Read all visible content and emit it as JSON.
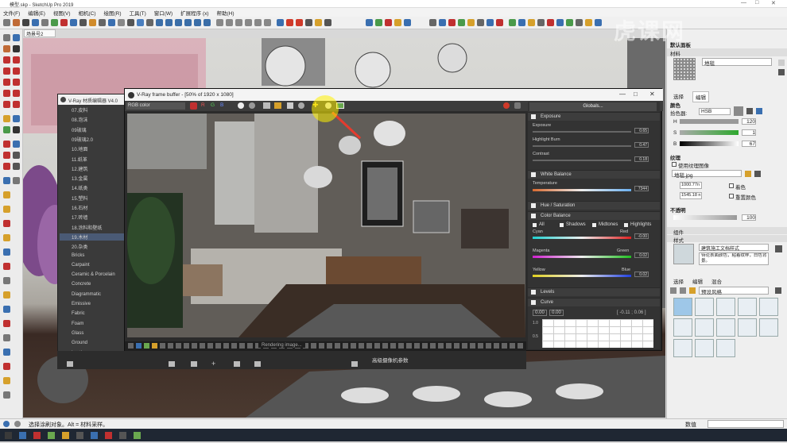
{
  "window": {
    "title": "模型.skp - SketchUp Pro 2019",
    "minimize": "—",
    "maximize": "□",
    "close": "✕"
  },
  "menu": [
    "文件(F)",
    "编辑(E)",
    "视图(V)",
    "相机(C)",
    "绘图(R)",
    "工具(T)",
    "窗口(W)",
    "扩展程序 (x)",
    "帮助(H)"
  ],
  "scene_tab": "场景号2",
  "material_editor": {
    "title": "V-Ray 材质编辑器 V4.0",
    "items": [
      "07.皮料",
      "08.泡沫",
      "09玻璃",
      "09玻璃2.0",
      "10.地面",
      "11.纸革",
      "12.建筑",
      "13.金属",
      "14.纸类",
      "15.塑料",
      "16.石材",
      "17.砖墙",
      "18.涂料和壁纸",
      "19.木材",
      "20.杂类",
      "Bricks",
      "Carpaint",
      "Ceramic & Porcelain",
      "Concrete",
      "Diagrammatic",
      "Emissive",
      "Fabric",
      "Foam",
      "Glass",
      "Ground",
      "Leather"
    ],
    "selected": "19.木材"
  },
  "vfb": {
    "title": "V-Ray frame buffer - [50% of 1920 x 1080]",
    "channel": "RGB color",
    "channel_btns": [
      "R",
      "G",
      "B"
    ],
    "status": "Rendering image...",
    "globals": "Globals...",
    "exposure": {
      "label": "Exposure",
      "params": [
        {
          "name": "Exposure",
          "value": "0.65"
        },
        {
          "name": "Highlight Burn",
          "value": "0.47"
        },
        {
          "name": "Contrast",
          "value": "0.18"
        }
      ]
    },
    "white_balance": {
      "label": "White Balance",
      "param": "Temperature",
      "value": "7344"
    },
    "hue_saturation": {
      "label": "Hue / Saturation"
    },
    "color_balance": {
      "label": "Color Balance",
      "modes": [
        "All",
        "Shadows",
        "Midtones",
        "Highlights"
      ],
      "rows": [
        {
          "left": "Cyan",
          "right": "Red",
          "value": "-0.00"
        },
        {
          "left": "Magenta",
          "right": "Green",
          "value": "0.02"
        },
        {
          "left": "Yellow",
          "right": "Blue",
          "value": "0.02"
        }
      ]
    },
    "levels": {
      "label": "Levels"
    },
    "curve": {
      "label": "Curve",
      "in": "0.00",
      "out": "0.00",
      "coords": "[ -0.11 ; 0.06 ]",
      "axis_top": "1.0",
      "axis_mid": "0.5"
    }
  },
  "vray_strip": {
    "row": "高级摄像机参数"
  },
  "right_panel": {
    "tray_title": "默认面板",
    "sec_material": "材料",
    "material_name": "地毯",
    "tabs": [
      "选择",
      "编辑"
    ],
    "color_label": "颜色",
    "picker_label": "拾色器:",
    "picker_mode": "HSB",
    "h_label": "H",
    "s_label": "S",
    "b_label": "B",
    "h_value": "120",
    "s_value": "1",
    "b_value": "67",
    "texture_label": "纹理",
    "use_texture": "使用纹理图像",
    "texture_file": "地毯.jpg",
    "tex_w": "1000.77n",
    "tex_h": "1545.18 n",
    "colorize": "着色",
    "reset_color": "重置颜色",
    "opacity_label": "不透明",
    "opacity_value": "100",
    "sec_components": "组件",
    "sec_styles": "样式",
    "style_name": "建筑施工文档样式",
    "style_desc": "待论表面颜色，粘着纹样，白色背景。",
    "style_tabs": [
      "选择",
      "编辑",
      "混合"
    ],
    "style_dropdown": "预设风格"
  },
  "status": {
    "hint": "选择涂刷对象。Alt = 材料采样。",
    "measure_label": "数值"
  },
  "watermark": "虎课网"
}
